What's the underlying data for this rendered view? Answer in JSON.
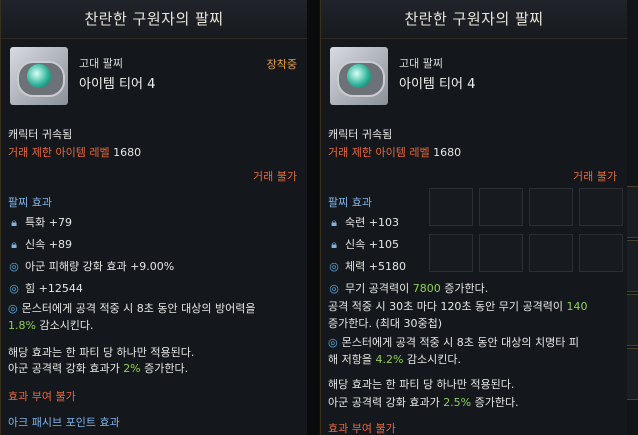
{
  "left": {
    "title": "찬란한 구원자의 팔찌",
    "grade": "고대 팔찌",
    "tier": "아이템 티어 4",
    "equipped": "장착중",
    "bound": "캐릭터 귀속됨",
    "level_label": "거래 제한 아이템 레벨",
    "level_value": "1680",
    "trade": "거래 불가",
    "effect_title": "팔찌 효과",
    "stats": [
      {
        "icon": "lock-icon",
        "text": "특화 +79"
      },
      {
        "icon": "lock-icon",
        "text": "신속 +89"
      },
      {
        "icon": "ring-icon",
        "text": "아군 피해량 강화 효과 +9.00%"
      },
      {
        "icon": "ring-icon",
        "text": "힘 +12544"
      }
    ],
    "desc1_a": "몬스터에게 공격 적중 시 8초 동안 대상의 방어력을",
    "desc1_b_green": "1.8%",
    "desc1_b_rest": " 감소시킨다.",
    "desc2": "해당 효과는 한 파티 당 하나만 적용된다.",
    "desc3_a": "아군 공격력 강화 효과가 ",
    "desc3_green": "2%",
    "desc3_b": " 증가한다.",
    "no_grant": "효과 부여 불가",
    "ark": "아크 패시브 포인트 효과"
  },
  "right": {
    "title": "찬란한 구원자의 팔찌",
    "grade": "고대 팔찌",
    "tier": "아이템 티어 4",
    "bound": "캐릭터 귀속됨",
    "level_label": "거래 제한 아이템 레벨",
    "level_value": "1680",
    "trade": "거래 불가",
    "effect_title": "팔찌 효과",
    "stats": [
      {
        "icon": "lock-icon",
        "text": "숙련 +103"
      },
      {
        "icon": "lock-icon",
        "text": "신속 +105"
      },
      {
        "icon": "ring-icon",
        "text": "체력 +5180"
      }
    ],
    "weapon_a": "무기 공격력이 ",
    "weapon_green": "7800",
    "weapon_b": " 증가한다.",
    "stack_a": "공격 적중 시 30초 마다 120초 동안 무기 공격력이 ",
    "stack_green": "140",
    "stack_b": "증가한다. (최대 30중첩)",
    "crit_a": "몬스터에게 공격 적중 시 8초 동안 대상의 치명타 피",
    "crit_b_pre": "해 저항을 ",
    "crit_green": "4.2%",
    "crit_b_post": " 감소시킨다.",
    "desc2": "해당 효과는 한 파티 당 하나만 적용된다.",
    "desc3_a": "아군 공격력 강화 효과가 ",
    "desc3_green": "2.5%",
    "desc3_b": " 증가한다.",
    "no_grant": "효과 부여 불가"
  }
}
